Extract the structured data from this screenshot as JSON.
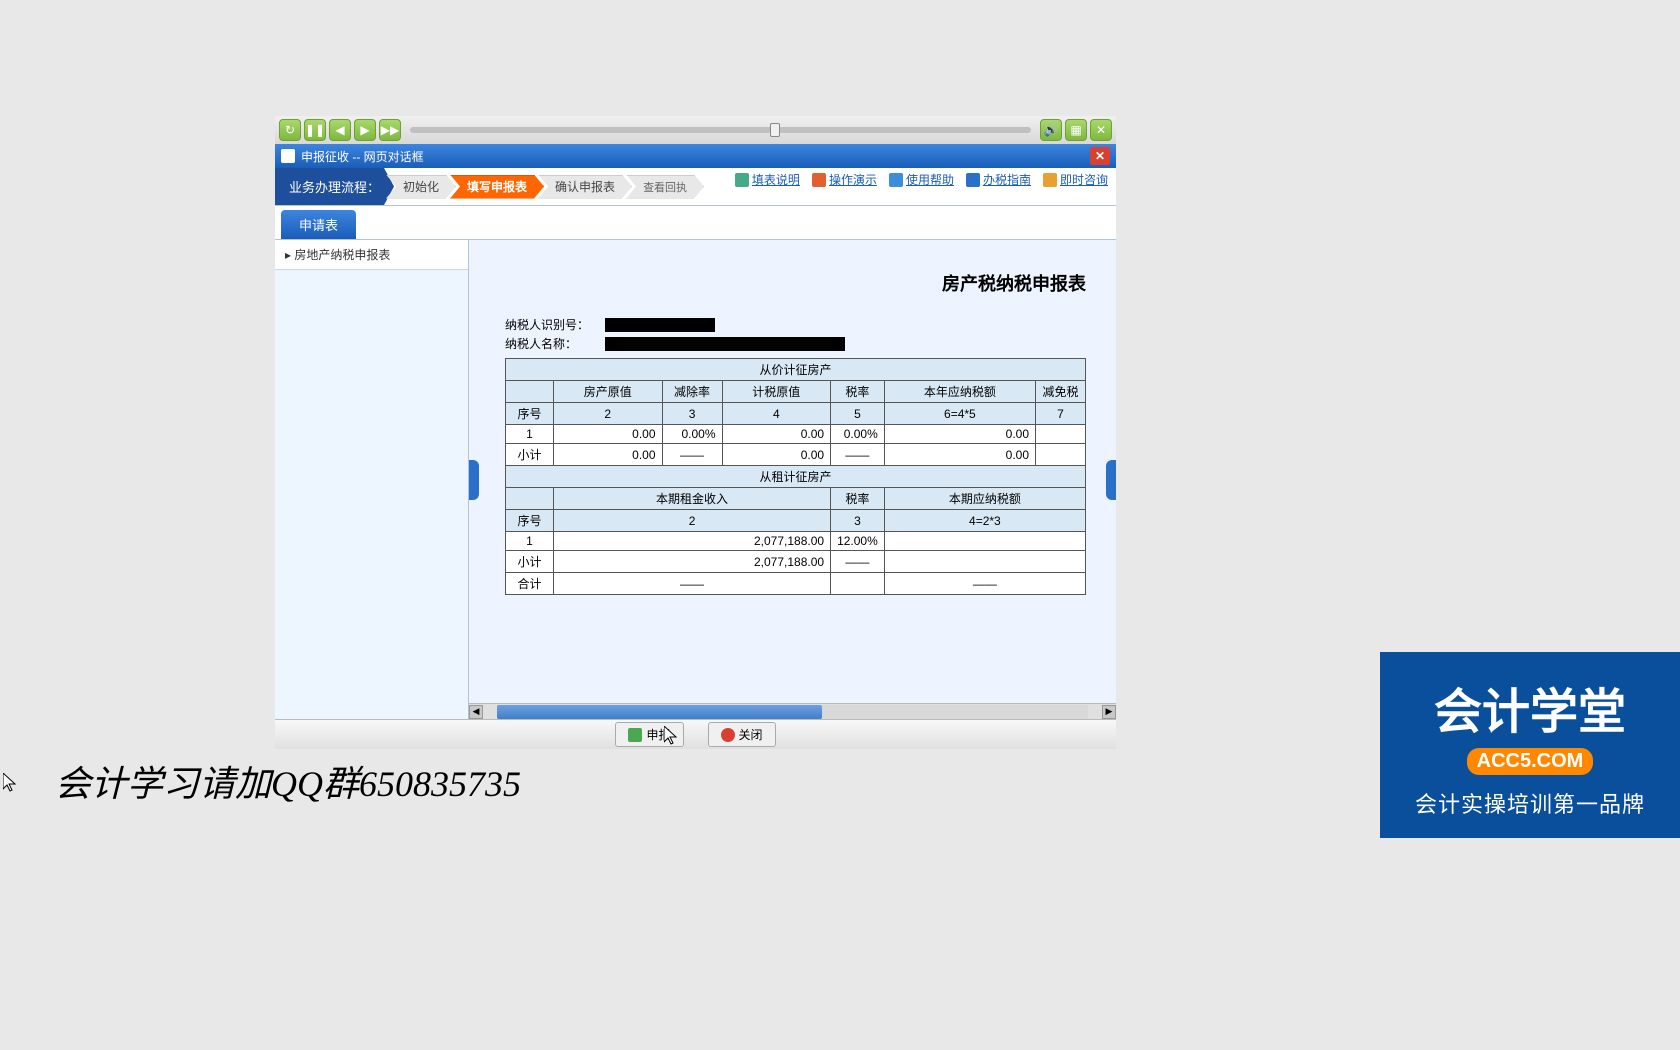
{
  "video_controls": {
    "progress_pct": 58
  },
  "dialog": {
    "title": "申报征收 -- 网页对话框"
  },
  "workflow": {
    "label": "业务办理流程：",
    "steps": [
      "初始化",
      "填写申报表",
      "确认申报表",
      "查看回执"
    ],
    "active_index": 1,
    "links": [
      "填表说明",
      "操作演示",
      "使用帮助",
      "办税指南",
      "即时咨询"
    ]
  },
  "tab": {
    "label": "申请表"
  },
  "sidebar": {
    "items": [
      "房地产纳税申报表"
    ]
  },
  "form": {
    "title": "房产税纳税申报表",
    "taxpayer_id_label": "纳税人识别号：",
    "taxpayer_name_label": "纳税人名称：",
    "section1_title": "从价计征房产",
    "table1": {
      "headers": [
        "",
        "房产原值",
        "减除率",
        "计税原值",
        "税率",
        "本年应纳税额",
        "减免税"
      ],
      "formula_row": [
        "序号",
        "2",
        "3",
        "4",
        "5",
        "6=4*5",
        "7"
      ],
      "rows": [
        [
          "1",
          "0.00",
          "0.00%",
          "0.00",
          "0.00%",
          "0.00",
          ""
        ],
        [
          "小计",
          "0.00",
          "——",
          "0.00",
          "——",
          "0.00",
          ""
        ]
      ]
    },
    "section2_title": "从租计征房产",
    "table2": {
      "headers": [
        "",
        "本期租金收入",
        "税率",
        "本期应纳税额"
      ],
      "formula_row": [
        "序号",
        "2",
        "3",
        "4=2*3"
      ],
      "rows": [
        [
          "1",
          "2,077,188.00",
          "12.00%",
          ""
        ],
        [
          "小计",
          "2,077,188.00",
          "——",
          ""
        ],
        [
          "合计",
          "——",
          "",
          "——"
        ]
      ]
    }
  },
  "bottom": {
    "submit": "申报",
    "close": "关闭"
  },
  "footer_text": "会计学习请加QQ群650835735",
  "brand": {
    "name": "会计学堂",
    "domain": "ACC5.COM",
    "tagline": "会计实操培训第一品牌"
  },
  "chart_data": {
    "type": "table",
    "title": "房产税纳税申报表",
    "sections": [
      {
        "name": "从价计征房产",
        "columns": [
          "序号",
          "房产原值",
          "减除率",
          "计税原值",
          "税率",
          "本年应纳税额"
        ],
        "rows": [
          {
            "序号": "1",
            "房产原值": 0.0,
            "减除率": 0.0,
            "计税原值": 0.0,
            "税率": 0.0,
            "本年应纳税额": 0.0
          },
          {
            "序号": "小计",
            "房产原值": 0.0,
            "减除率": null,
            "计税原值": 0.0,
            "税率": null,
            "本年应纳税额": 0.0
          }
        ]
      },
      {
        "name": "从租计征房产",
        "columns": [
          "序号",
          "本期租金收入",
          "税率",
          "本期应纳税额"
        ],
        "rows": [
          {
            "序号": "1",
            "本期租金收入": 2077188.0,
            "税率": 12.0,
            "本期应纳税额": null
          },
          {
            "序号": "小计",
            "本期租金收入": 2077188.0,
            "税率": null,
            "本期应纳税额": null
          },
          {
            "序号": "合计",
            "本期租金收入": null,
            "税率": null,
            "本期应纳税额": null
          }
        ]
      }
    ]
  }
}
